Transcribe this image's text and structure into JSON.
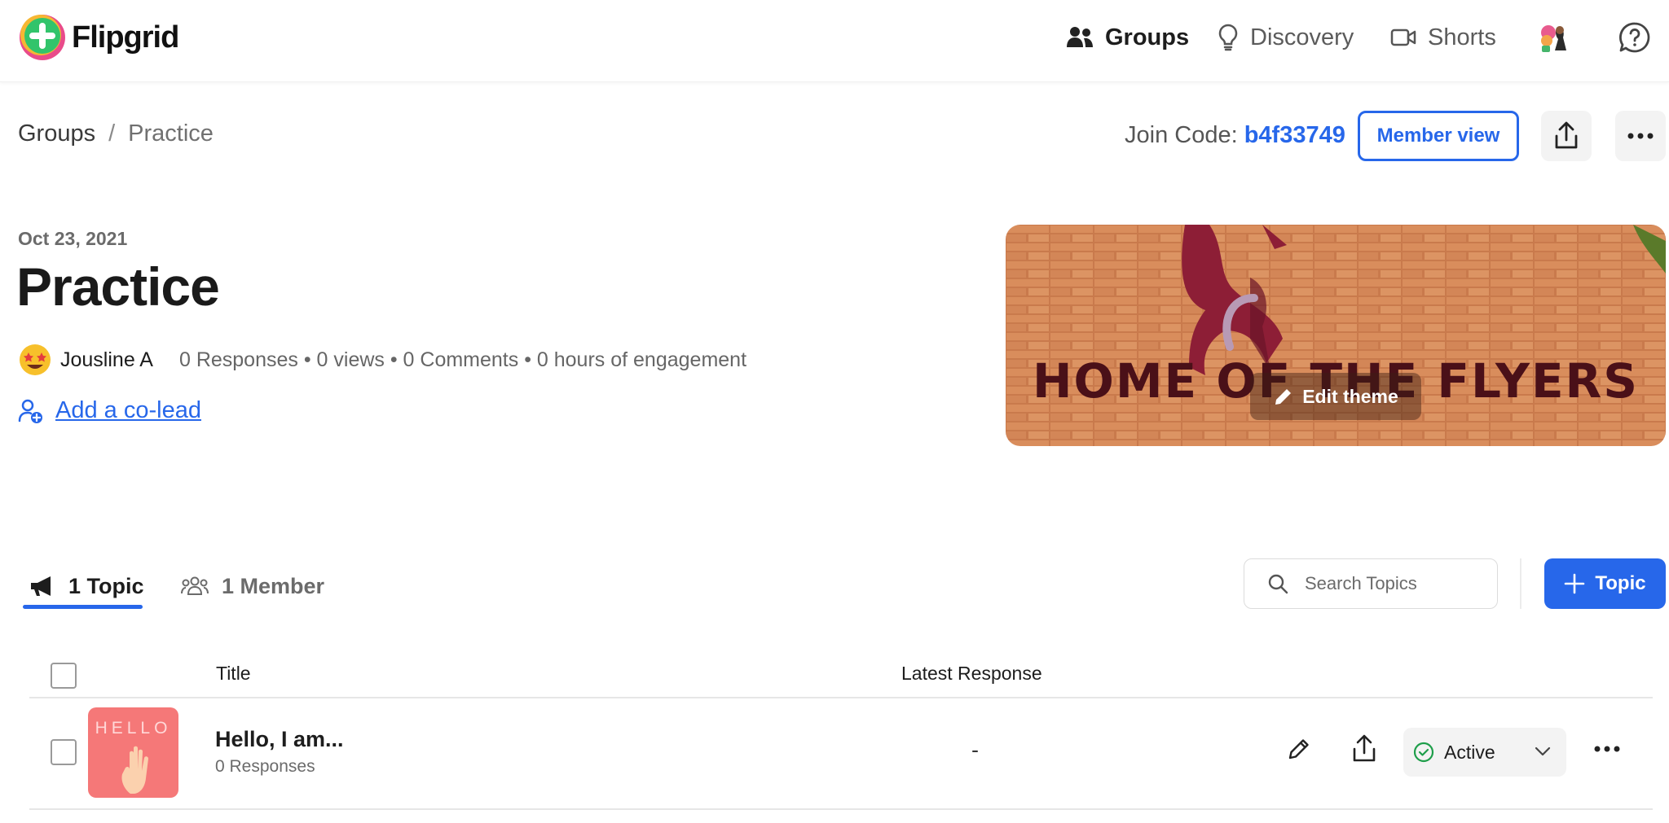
{
  "app": {
    "name": "Flipgrid"
  },
  "nav": {
    "items": [
      {
        "label": "Groups",
        "icon": "groups-icon",
        "active": true
      },
      {
        "label": "Discovery",
        "icon": "lightbulb-icon",
        "active": false
      },
      {
        "label": "Shorts",
        "icon": "video-camera-icon",
        "active": false
      }
    ]
  },
  "breadcrumb": {
    "root": "Groups",
    "separator": "/",
    "current": "Practice"
  },
  "join": {
    "label": "Join Code: ",
    "code": "b4f33749"
  },
  "actions": {
    "member_view": "Member view"
  },
  "group": {
    "date": "Oct 23, 2021",
    "title": "Practice",
    "owner": "Jousline A",
    "stats": "0 Responses • 0 views • 0 Comments • 0 hours of engagement",
    "add_colead": "Add a co-lead"
  },
  "banner": {
    "sign_text": "HOME OF THE FLYERS",
    "edit_label": "Edit theme"
  },
  "tabs": [
    {
      "label": "1 Topic",
      "active": true
    },
    {
      "label": "1 Member",
      "active": false
    }
  ],
  "search": {
    "placeholder": "Search Topics"
  },
  "add_topic": {
    "label": "Topic"
  },
  "table": {
    "headers": {
      "title": "Title",
      "latest": "Latest Response"
    },
    "rows": [
      {
        "thumb_text": "HELLO",
        "title": "Hello, I am...",
        "subtitle": "0 Responses",
        "latest": "-",
        "status": "Active"
      }
    ]
  },
  "colors": {
    "accent": "#2767ea",
    "active_green": "#1e9e4a",
    "thumb_bg": "#f57878"
  }
}
